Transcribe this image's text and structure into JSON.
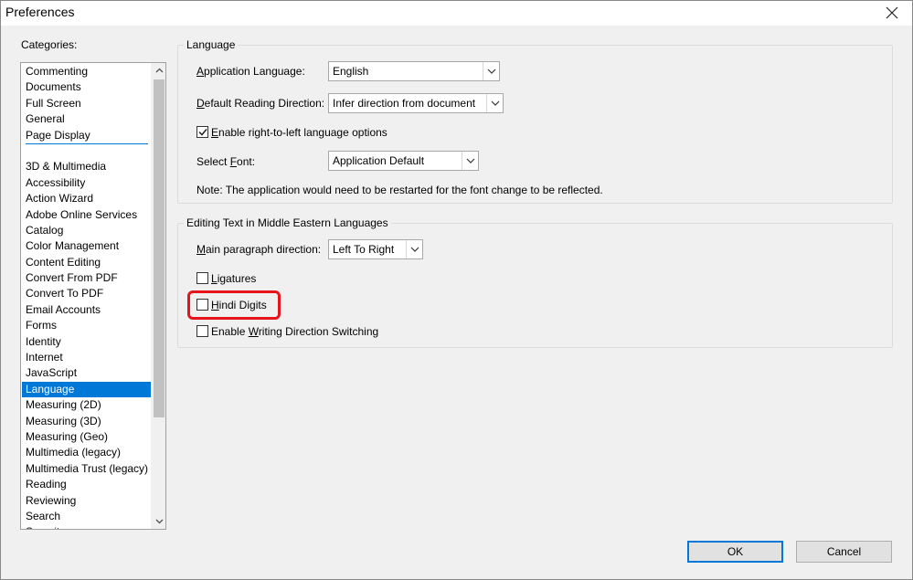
{
  "window": {
    "title": "Preferences",
    "close_glyph": "✕"
  },
  "categories": {
    "label": "Categories:",
    "top_items": [
      "Commenting",
      "Documents",
      "Full Screen",
      "General",
      "Page Display"
    ],
    "items": [
      "3D & Multimedia",
      "Accessibility",
      "Action Wizard",
      "Adobe Online Services",
      "Catalog",
      "Color Management",
      "Content Editing",
      "Convert From PDF",
      "Convert To PDF",
      "Email Accounts",
      "Forms",
      "Identity",
      "Internet",
      "JavaScript",
      "Language",
      "Measuring (2D)",
      "Measuring (3D)",
      "Measuring (Geo)",
      "Multimedia (legacy)",
      "Multimedia Trust (legacy)",
      "Reading",
      "Reviewing",
      "Search",
      "Security"
    ],
    "selected": "Language"
  },
  "language_group": {
    "title": "Language",
    "app_language": {
      "label_pre": "",
      "label_u": "A",
      "label_post": "pplication Language:",
      "value": "English"
    },
    "reading_direction": {
      "label_pre": "",
      "label_u": "D",
      "label_post": "efault Reading Direction:",
      "value": "Infer direction from document"
    },
    "rtl_option": {
      "label_pre": "",
      "label_u": "E",
      "label_post": "nable right-to-left language options",
      "checked": true
    },
    "select_font": {
      "label_pre": "Select ",
      "label_u": "F",
      "label_post": "ont:",
      "value": "Application Default"
    },
    "note": "Note: The application would need to be restarted for the font change to be reflected."
  },
  "middle_eastern_group": {
    "title": "Editing Text in Middle Eastern Languages",
    "paragraph_direction": {
      "label_pre": "",
      "label_u": "M",
      "label_post": "ain paragraph direction:",
      "value": "Left To Right"
    },
    "ligatures": {
      "label_pre": "",
      "label_u": "L",
      "label_post": "igatures",
      "checked": false
    },
    "hindi_digits": {
      "label_pre": "",
      "label_u": "H",
      "label_post": "indi Digits",
      "checked": false
    },
    "writing_direction": {
      "label_pre": "Enable ",
      "label_u": "W",
      "label_post": "riting Direction Switching",
      "checked": false
    }
  },
  "buttons": {
    "ok": "OK",
    "cancel": "Cancel"
  },
  "icons": {
    "dropdown": "chevron-down-icon",
    "check": "checkmark-icon",
    "scroll_up": "▲",
    "scroll_down": "▼"
  },
  "colors": {
    "selection": "#0078d7",
    "highlight_ring": "#e8141c"
  }
}
